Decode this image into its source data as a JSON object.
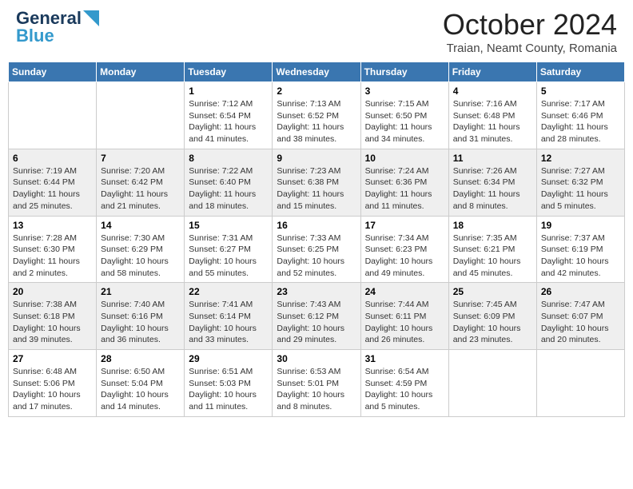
{
  "header": {
    "logo_line1": "General",
    "logo_line2": "Blue",
    "month_title": "October 2024",
    "location": "Traian, Neamt County, Romania"
  },
  "weekdays": [
    "Sunday",
    "Monday",
    "Tuesday",
    "Wednesday",
    "Thursday",
    "Friday",
    "Saturday"
  ],
  "weeks": [
    [
      {
        "day": "",
        "sunrise": "",
        "sunset": "",
        "daylight": ""
      },
      {
        "day": "",
        "sunrise": "",
        "sunset": "",
        "daylight": ""
      },
      {
        "day": "1",
        "sunrise": "Sunrise: 7:12 AM",
        "sunset": "Sunset: 6:54 PM",
        "daylight": "Daylight: 11 hours and 41 minutes."
      },
      {
        "day": "2",
        "sunrise": "Sunrise: 7:13 AM",
        "sunset": "Sunset: 6:52 PM",
        "daylight": "Daylight: 11 hours and 38 minutes."
      },
      {
        "day": "3",
        "sunrise": "Sunrise: 7:15 AM",
        "sunset": "Sunset: 6:50 PM",
        "daylight": "Daylight: 11 hours and 34 minutes."
      },
      {
        "day": "4",
        "sunrise": "Sunrise: 7:16 AM",
        "sunset": "Sunset: 6:48 PM",
        "daylight": "Daylight: 11 hours and 31 minutes."
      },
      {
        "day": "5",
        "sunrise": "Sunrise: 7:17 AM",
        "sunset": "Sunset: 6:46 PM",
        "daylight": "Daylight: 11 hours and 28 minutes."
      }
    ],
    [
      {
        "day": "6",
        "sunrise": "Sunrise: 7:19 AM",
        "sunset": "Sunset: 6:44 PM",
        "daylight": "Daylight: 11 hours and 25 minutes."
      },
      {
        "day": "7",
        "sunrise": "Sunrise: 7:20 AM",
        "sunset": "Sunset: 6:42 PM",
        "daylight": "Daylight: 11 hours and 21 minutes."
      },
      {
        "day": "8",
        "sunrise": "Sunrise: 7:22 AM",
        "sunset": "Sunset: 6:40 PM",
        "daylight": "Daylight: 11 hours and 18 minutes."
      },
      {
        "day": "9",
        "sunrise": "Sunrise: 7:23 AM",
        "sunset": "Sunset: 6:38 PM",
        "daylight": "Daylight: 11 hours and 15 minutes."
      },
      {
        "day": "10",
        "sunrise": "Sunrise: 7:24 AM",
        "sunset": "Sunset: 6:36 PM",
        "daylight": "Daylight: 11 hours and 11 minutes."
      },
      {
        "day": "11",
        "sunrise": "Sunrise: 7:26 AM",
        "sunset": "Sunset: 6:34 PM",
        "daylight": "Daylight: 11 hours and 8 minutes."
      },
      {
        "day": "12",
        "sunrise": "Sunrise: 7:27 AM",
        "sunset": "Sunset: 6:32 PM",
        "daylight": "Daylight: 11 hours and 5 minutes."
      }
    ],
    [
      {
        "day": "13",
        "sunrise": "Sunrise: 7:28 AM",
        "sunset": "Sunset: 6:30 PM",
        "daylight": "Daylight: 11 hours and 2 minutes."
      },
      {
        "day": "14",
        "sunrise": "Sunrise: 7:30 AM",
        "sunset": "Sunset: 6:29 PM",
        "daylight": "Daylight: 10 hours and 58 minutes."
      },
      {
        "day": "15",
        "sunrise": "Sunrise: 7:31 AM",
        "sunset": "Sunset: 6:27 PM",
        "daylight": "Daylight: 10 hours and 55 minutes."
      },
      {
        "day": "16",
        "sunrise": "Sunrise: 7:33 AM",
        "sunset": "Sunset: 6:25 PM",
        "daylight": "Daylight: 10 hours and 52 minutes."
      },
      {
        "day": "17",
        "sunrise": "Sunrise: 7:34 AM",
        "sunset": "Sunset: 6:23 PM",
        "daylight": "Daylight: 10 hours and 49 minutes."
      },
      {
        "day": "18",
        "sunrise": "Sunrise: 7:35 AM",
        "sunset": "Sunset: 6:21 PM",
        "daylight": "Daylight: 10 hours and 45 minutes."
      },
      {
        "day": "19",
        "sunrise": "Sunrise: 7:37 AM",
        "sunset": "Sunset: 6:19 PM",
        "daylight": "Daylight: 10 hours and 42 minutes."
      }
    ],
    [
      {
        "day": "20",
        "sunrise": "Sunrise: 7:38 AM",
        "sunset": "Sunset: 6:18 PM",
        "daylight": "Daylight: 10 hours and 39 minutes."
      },
      {
        "day": "21",
        "sunrise": "Sunrise: 7:40 AM",
        "sunset": "Sunset: 6:16 PM",
        "daylight": "Daylight: 10 hours and 36 minutes."
      },
      {
        "day": "22",
        "sunrise": "Sunrise: 7:41 AM",
        "sunset": "Sunset: 6:14 PM",
        "daylight": "Daylight: 10 hours and 33 minutes."
      },
      {
        "day": "23",
        "sunrise": "Sunrise: 7:43 AM",
        "sunset": "Sunset: 6:12 PM",
        "daylight": "Daylight: 10 hours and 29 minutes."
      },
      {
        "day": "24",
        "sunrise": "Sunrise: 7:44 AM",
        "sunset": "Sunset: 6:11 PM",
        "daylight": "Daylight: 10 hours and 26 minutes."
      },
      {
        "day": "25",
        "sunrise": "Sunrise: 7:45 AM",
        "sunset": "Sunset: 6:09 PM",
        "daylight": "Daylight: 10 hours and 23 minutes."
      },
      {
        "day": "26",
        "sunrise": "Sunrise: 7:47 AM",
        "sunset": "Sunset: 6:07 PM",
        "daylight": "Daylight: 10 hours and 20 minutes."
      }
    ],
    [
      {
        "day": "27",
        "sunrise": "Sunrise: 6:48 AM",
        "sunset": "Sunset: 5:06 PM",
        "daylight": "Daylight: 10 hours and 17 minutes."
      },
      {
        "day": "28",
        "sunrise": "Sunrise: 6:50 AM",
        "sunset": "Sunset: 5:04 PM",
        "daylight": "Daylight: 10 hours and 14 minutes."
      },
      {
        "day": "29",
        "sunrise": "Sunrise: 6:51 AM",
        "sunset": "Sunset: 5:03 PM",
        "daylight": "Daylight: 10 hours and 11 minutes."
      },
      {
        "day": "30",
        "sunrise": "Sunrise: 6:53 AM",
        "sunset": "Sunset: 5:01 PM",
        "daylight": "Daylight: 10 hours and 8 minutes."
      },
      {
        "day": "31",
        "sunrise": "Sunrise: 6:54 AM",
        "sunset": "Sunset: 4:59 PM",
        "daylight": "Daylight: 10 hours and 5 minutes."
      },
      {
        "day": "",
        "sunrise": "",
        "sunset": "",
        "daylight": ""
      },
      {
        "day": "",
        "sunrise": "",
        "sunset": "",
        "daylight": ""
      }
    ]
  ]
}
